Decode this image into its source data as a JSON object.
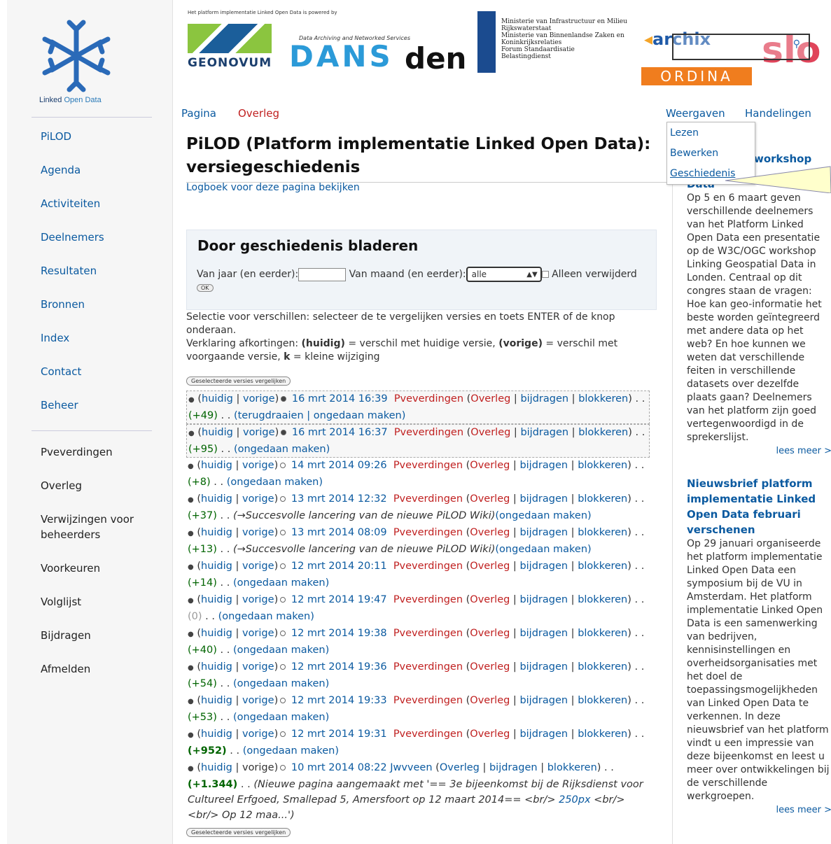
{
  "logo": {
    "text_a": "Linked ",
    "text_b": "Open Data"
  },
  "banner": {
    "powered_by": "Het platform implementatie Linked Open Data is powered by",
    "geonovum": "GEONOVUM",
    "dans": "DANS",
    "dans_sub": "Data Archiving and Networked Services",
    "den": "den",
    "ministry_lines": [
      "Ministerie van Infrastructuur en Milieu",
      "Rijkswaterstaat",
      "Ministerie van Binnenlandse Zaken en",
      "Koninkrijksrelaties",
      "Forum Standaardisatie",
      "Belastingdienst"
    ],
    "archix": "archix",
    "ordina": "ORDINA",
    "slo": "slo"
  },
  "nav_main": [
    "PiLOD",
    "Agenda",
    "Activiteiten",
    "Deelnemers",
    "Resultaten",
    "Bronnen",
    "Index",
    "Contact",
    "Beheer"
  ],
  "nav_user": [
    "Pveverdingen",
    "Overleg",
    "Verwijzingen voor beheerders",
    "Voorkeuren",
    "Volglijst",
    "Bijdragen",
    "Afmelden"
  ],
  "tabs": {
    "left": [
      "Pagina",
      "Overleg"
    ],
    "right": [
      "Weergaven",
      "Handelingen"
    ]
  },
  "dropdown": [
    "Lezen",
    "Bewerken",
    "Geschiedenis"
  ],
  "title": "PiLOD (Platform implementatie Linked Open Data): versiegeschiedenis",
  "logbook_link": "Logboek voor deze pagina bekijken",
  "browse": {
    "heading": "Door geschiedenis bladeren",
    "year_label": "Van jaar (en eerder):",
    "month_label": "Van maand (en eerder):",
    "month_value": "alle",
    "deleted_label": "Alleen verwijderd",
    "ok_label": "OK"
  },
  "explain": {
    "line1": "Selectie voor verschillen: selecteer de te vergelijken versies en toets ENTER of de knop onderaan.",
    "legend_prefix": "Verklaring afkortingen: ",
    "cur": "(huidig)",
    "cur_text": " = verschil met huidige versie, ",
    "prev": "(vorige)",
    "prev_text": " = verschil met voorgaande versie, ",
    "k": "k",
    "k_text": " = kleine wijziging"
  },
  "compare_button": "Geselecteerde versies vergelijken",
  "history": [
    {
      "date": "16 mrt 2014 16:39",
      "user": "Pveverdingen",
      "size": "(+49)",
      "actions": "(terugdraaien | ongedaan maken)",
      "summary": "",
      "selected": true,
      "radio": "on"
    },
    {
      "date": "16 mrt 2014 16:37",
      "user": "Pveverdingen",
      "size": "(+95)",
      "actions": "(ongedaan maken)",
      "summary": "",
      "selected": true,
      "radio": "on"
    },
    {
      "date": "14 mrt 2014 09:26",
      "user": "Pveverdingen",
      "size": "(+8)",
      "actions": "(ongedaan maken)",
      "summary": ""
    },
    {
      "date": "13 mrt 2014 12:32",
      "user": "Pveverdingen",
      "size": "(+37)",
      "actions": "(ongedaan maken)",
      "summary": "(→Succesvolle lancering van de nieuwe PiLOD Wiki)"
    },
    {
      "date": "13 mrt 2014 08:09",
      "user": "Pveverdingen",
      "size": "(+13)",
      "actions": "(ongedaan maken)",
      "summary": "(→Succesvolle lancering van de nieuwe PiLOD Wiki)"
    },
    {
      "date": "12 mrt 2014 20:11",
      "user": "Pveverdingen",
      "size": "(+14)",
      "actions": "(ongedaan maken)",
      "summary": ""
    },
    {
      "date": "12 mrt 2014 19:47",
      "user": "Pveverdingen",
      "size": "(0)",
      "actions": "(ongedaan maken)",
      "summary": ""
    },
    {
      "date": "12 mrt 2014 19:38",
      "user": "Pveverdingen",
      "size": "(+40)",
      "actions": "(ongedaan maken)",
      "summary": ""
    },
    {
      "date": "12 mrt 2014 19:36",
      "user": "Pveverdingen",
      "size": "(+54)",
      "actions": "(ongedaan maken)",
      "summary": ""
    },
    {
      "date": "12 mrt 2014 19:33",
      "user": "Pveverdingen",
      "size": "(+53)",
      "actions": "(ongedaan maken)",
      "summary": ""
    },
    {
      "date": "12 mrt 2014 19:31",
      "user": "Pveverdingen",
      "size": "(+952)",
      "actions": "(ongedaan maken)",
      "summary": ""
    }
  ],
  "history_last": {
    "date": "10 mrt 2014 08:22",
    "user": "Jwvveen",
    "size": "(+1.344)",
    "summary_a": "(Nieuwe pagina aangemaakt met '== 3e bijeenkomst bij de Rijksdienst voor Cultureel Erfgoed, Smallepad 5, Amersfoort op 12 maart 2014== <br/> ",
    "summary_link": "250px",
    "summary_b": " <br/><br/> Op 12 maa...')"
  },
  "row_labels": {
    "cur": "huidig",
    "prev": "vorige",
    "talk": "Overleg",
    "contrib": "bijdragen",
    "block": "blokkeren"
  },
  "news": [
    {
      "title_partial": "workshop",
      "title_tail": "Data",
      "body": "Op 5 en 6 maart geven verschillende deelnemers van het Platform Linked Open Data een presentatie op de W3C/OGC workshop Linking Geospatial Data in Londen. Centraal op dit congres staan de vragen: Hoe kan geo-informatie het beste worden geïntegreerd met andere data op het web? En hoe kunnen we weten dat verschillende feiten in verschillende datasets over dezelfde plaats gaan? Deelnemers van het platform zijn goed vertegenwoordigd in de sprekerslijst.",
      "more": "lees meer >"
    },
    {
      "title": "Nieuwsbrief platform implementatie Linked Open Data februari verschenen",
      "body": "Op 29 januari organiseerde het platform implementatie Linked Open Data een symposium bij de VU in Amsterdam. Het platform implementatie Linked Open Data is een samenwerking van bedrijven, kennisinstellingen en overheidsorganisaties met het doel de toepassingsmogelijkheden van Linked Open Data te verkennen. In deze nieuwsbrief van het platform vindt u een impressie van deze bijeenkomst en leest u meer over ontwikkelingen bij de verschillende werkgroepen.",
      "more": "lees meer >"
    }
  ]
}
